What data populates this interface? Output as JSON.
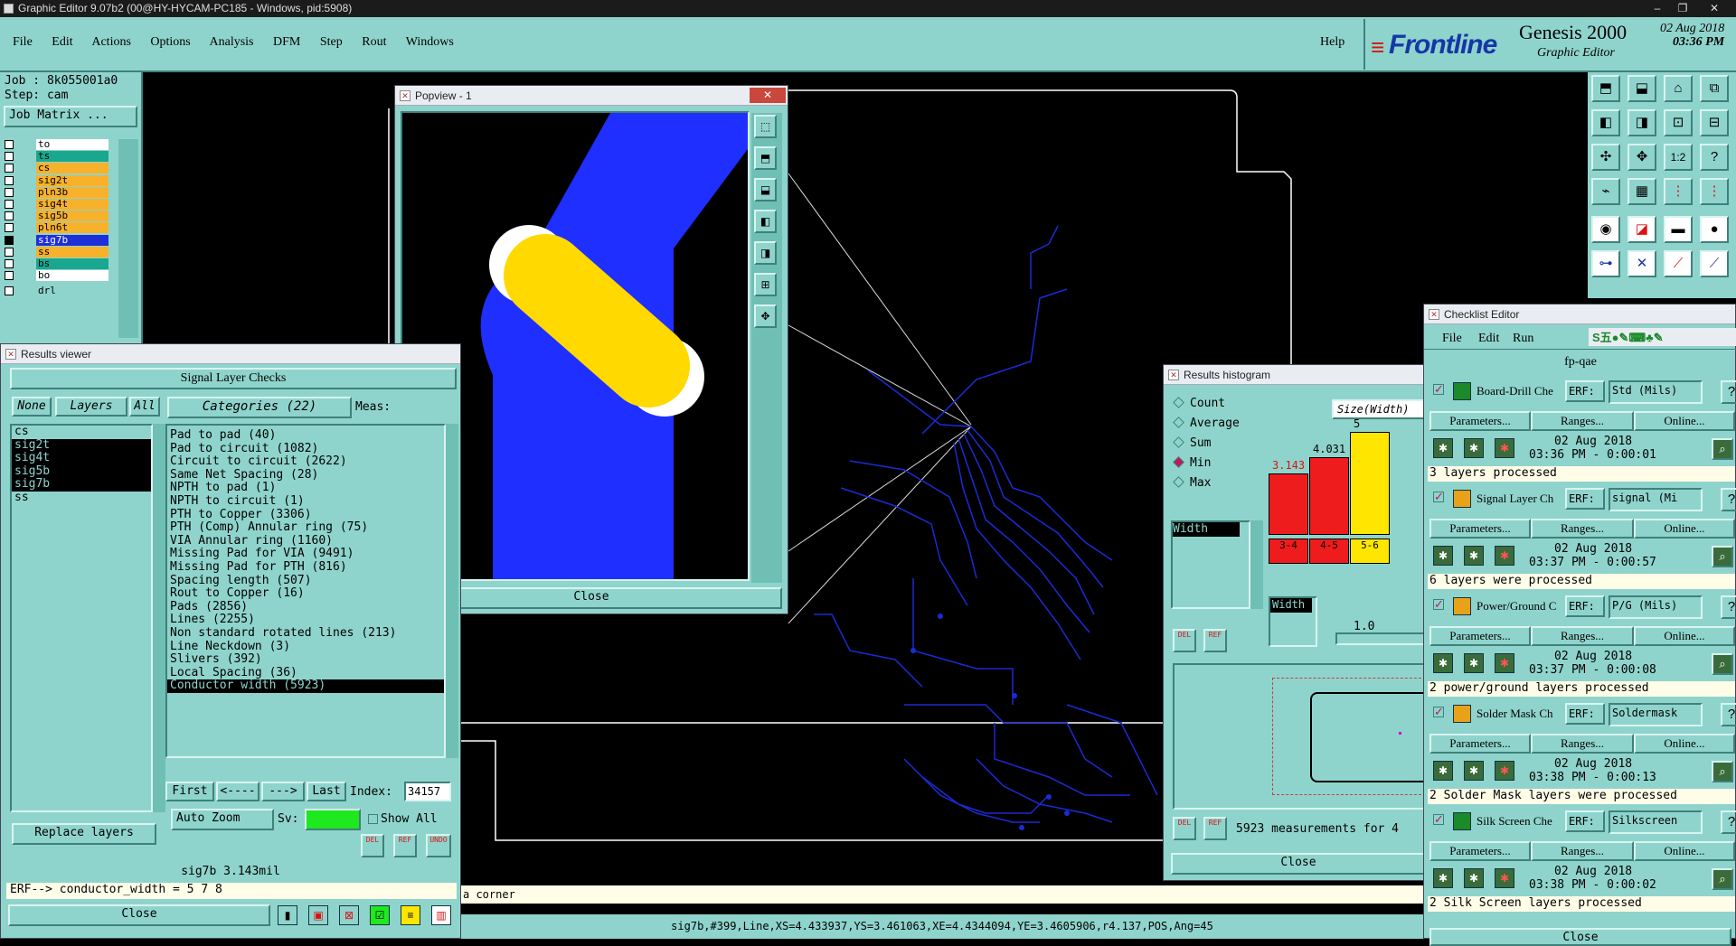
{
  "titlebar": {
    "title": "Graphic Editor 9.07b2 (00@HY-HYCAM-PC185 - Windows, pid:5908)"
  },
  "menubar": {
    "items": [
      "File",
      "Edit",
      "Actions",
      "Options",
      "Analysis",
      "DFM",
      "Step",
      "Rout",
      "Windows"
    ],
    "help": "Help"
  },
  "brand": {
    "logo": "Frontline",
    "product": "Genesis 2000",
    "subtitle": "Graphic Editor",
    "date": "02 Aug 2018",
    "time": "03:36 PM"
  },
  "job": {
    "job_label": "Job : 8k055001a0",
    "step_label": "Step: cam",
    "matrix_button": "Job Matrix ..."
  },
  "layers": [
    {
      "name": "to",
      "color": "#ffffff"
    },
    {
      "name": "ts",
      "color": "#19a88e"
    },
    {
      "name": "cs",
      "color": "#f7b12a"
    },
    {
      "name": "sig2t",
      "color": "#f7b12a"
    },
    {
      "name": "pln3b",
      "color": "#f7b12a"
    },
    {
      "name": "sig4t",
      "color": "#f7b12a"
    },
    {
      "name": "sig5b",
      "color": "#f7b12a"
    },
    {
      "name": "pln6t",
      "color": "#f7b12a"
    },
    {
      "name": "sig7b",
      "color": "#1f2fd8"
    },
    {
      "name": "ss",
      "color": "#f7b12a"
    },
    {
      "name": "bs",
      "color": "#19a88e"
    },
    {
      "name": "bo",
      "color": "#ffffff"
    },
    {
      "name": "drl",
      "color": "#8fd4cc"
    }
  ],
  "results_viewer": {
    "title": "Results viewer",
    "header": "Signal Layer Checks",
    "buttons": {
      "none": "None",
      "layers": "Layers",
      "all": "All",
      "categories": "Categories (22)",
      "meas": "Meas:"
    },
    "layer_list": [
      {
        "t": "cs",
        "sel": false
      },
      {
        "t": "sig2t",
        "sel": true
      },
      {
        "t": "sig4t",
        "sel": true
      },
      {
        "t": "sig5b",
        "sel": true
      },
      {
        "t": "sig7b",
        "sel": true
      },
      {
        "t": "ss",
        "sel": false
      }
    ],
    "categories": [
      {
        "t": "Pad to pad (40)",
        "sel": false
      },
      {
        "t": "Pad to circuit (1082)",
        "sel": false
      },
      {
        "t": "Circuit to circuit (2622)",
        "sel": false
      },
      {
        "t": "Same Net Spacing (28)",
        "sel": false
      },
      {
        "t": "NPTH to pad (1)",
        "sel": false
      },
      {
        "t": "NPTH to circuit (1)",
        "sel": false
      },
      {
        "t": "PTH to Copper (3306)",
        "sel": false
      },
      {
        "t": "PTH (Comp) Annular ring (75)",
        "sel": false
      },
      {
        "t": "VIA Annular ring (1160)",
        "sel": false
      },
      {
        "t": "Missing Pad for VIA (9491)",
        "sel": false
      },
      {
        "t": "Missing Pad for PTH (816)",
        "sel": false
      },
      {
        "t": "Spacing length (507)",
        "sel": false
      },
      {
        "t": "Rout to Copper (16)",
        "sel": false
      },
      {
        "t": "Pads (2856)",
        "sel": false
      },
      {
        "t": "Lines (2255)",
        "sel": false
      },
      {
        "t": "Non standard rotated lines (213)",
        "sel": false
      },
      {
        "t": "Line Neckdown (3)",
        "sel": false
      },
      {
        "t": "Slivers (392)",
        "sel": false
      },
      {
        "t": "Local Spacing (36)",
        "sel": false
      },
      {
        "t": "Conductor width (5923)",
        "sel": true
      }
    ],
    "nav": {
      "first": "First",
      "prev": "<----",
      "next": "--->",
      "last": "Last",
      "index_label": "Index:",
      "index_value": "34157"
    },
    "auto_zoom": "Auto Zoom",
    "sv": "Sv:",
    "show_all": "Show All",
    "replace_layers": "Replace layers",
    "small": {
      "del": "DEL",
      "ref": "REF",
      "undo": "UNDO"
    },
    "status": "sig7b 3.143mil",
    "erf": "ERF--> conductor_width = 5 7 8",
    "close": "Close"
  },
  "popview": {
    "title": "Popview - 1",
    "close": "Close"
  },
  "histogram": {
    "title": "Results histogram",
    "options": [
      "Count",
      "Average",
      "Sum",
      "Min",
      "Max"
    ],
    "selected": "Min",
    "field": "Width",
    "axis_label": "Size(Width)",
    "bars": [
      {
        "value": "3.143",
        "range": "3-4",
        "color": "#ee1c1c",
        "h": 0.52
      },
      {
        "value": "4.031",
        "range": "4-5",
        "color": "#ee1c1c",
        "h": 0.66
      },
      {
        "value": "5",
        "range": "5-6",
        "color": "#ffe600",
        "h": 0.88
      }
    ],
    "width_field": "Width",
    "step_value": "1.0",
    "measurements": "5923 measurements for 4",
    "close": "Close",
    "del": "DEL",
    "ref": "REF"
  },
  "checklist": {
    "title": "Checklist Editor",
    "menu": [
      "File",
      "Edit",
      "Run"
    ],
    "name": "fp-qae",
    "erf_label": "ERF:",
    "param": "Parameters...",
    "ranges": "Ranges...",
    "online": "Online...",
    "rows": [
      {
        "name": "Board-Drill Che",
        "erf": "Std (Mils)",
        "date": "02 Aug 2018",
        "time": "03:36 PM - 0:00:01",
        "status": "3 layers processed"
      },
      {
        "name": "Signal Layer Ch",
        "erf": "signal (Mi",
        "date": "02 Aug 2018",
        "time": "03:37 PM - 0:00:57",
        "status": "6 layers were processed"
      },
      {
        "name": "Power/Ground C",
        "erf": "P/G (Mils)",
        "date": "02 Aug 2018",
        "time": "03:37 PM - 0:00:08",
        "status": "2 power/ground layers processed"
      },
      {
        "name": "Solder Mask Ch",
        "erf": "Soldermask",
        "date": "02 Aug 2018",
        "time": "03:38 PM - 0:00:13",
        "status": "2 Solder Mask layers were processed"
      },
      {
        "name": "Silk Screen Che",
        "erf": "Silkscreen",
        "date": "02 Aug 2018",
        "time": "03:38 PM - 0:00:02",
        "status": "2 Silk Screen layers processed"
      }
    ],
    "close": "Close"
  },
  "statusbar": {
    "message": "a corner",
    "feature": "sig7b,#399,Line,XS=4.433937,YS=3.461063,XE=4.4344094,YE=3.4605906,r4.137,POS,Ang=45"
  }
}
